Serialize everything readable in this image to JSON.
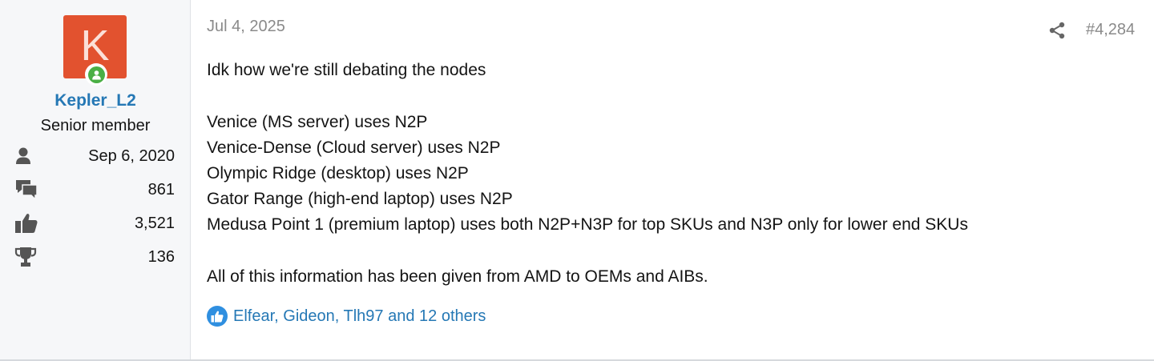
{
  "user": {
    "avatar_letter": "K",
    "avatar_color": "#e2522f",
    "online_status_color": "#4aaf45",
    "username": "Kepler_L2",
    "title": "Senior member",
    "stats": [
      {
        "icon": "user-icon",
        "value": "Sep 6, 2020"
      },
      {
        "icon": "messages-icon",
        "value": "861"
      },
      {
        "icon": "thumbs-up-icon",
        "value": "3,521"
      },
      {
        "icon": "trophy-icon",
        "value": "136"
      }
    ]
  },
  "post": {
    "date": "Jul 4, 2025",
    "number": "#4,284",
    "share_icon": "share-icon",
    "lines": {
      "intro": "Idk how we're still debating the nodes",
      "l1": "Venice (MS server) uses N2P",
      "l2": "Venice-Dense (Cloud server) uses N2P",
      "l3": "Olympic Ridge (desktop) uses N2P",
      "l4": "Gator Range (high-end laptop) uses N2P",
      "l5": "Medusa Point 1 (premium laptop) uses both N2P+N3P for top SKUs and N3P only for lower end SKUs",
      "outro": "All of this information has been given from AMD to OEMs and AIBs."
    },
    "reactions": {
      "icon": "like-icon",
      "text": "Elfear, Gideon, Tlh97 and 12 others"
    }
  },
  "colors": {
    "link": "#2578b5",
    "muted": "#8a8a8a",
    "sidebar_bg": "#f6f7f9",
    "like_blue": "#2f8fe0"
  }
}
